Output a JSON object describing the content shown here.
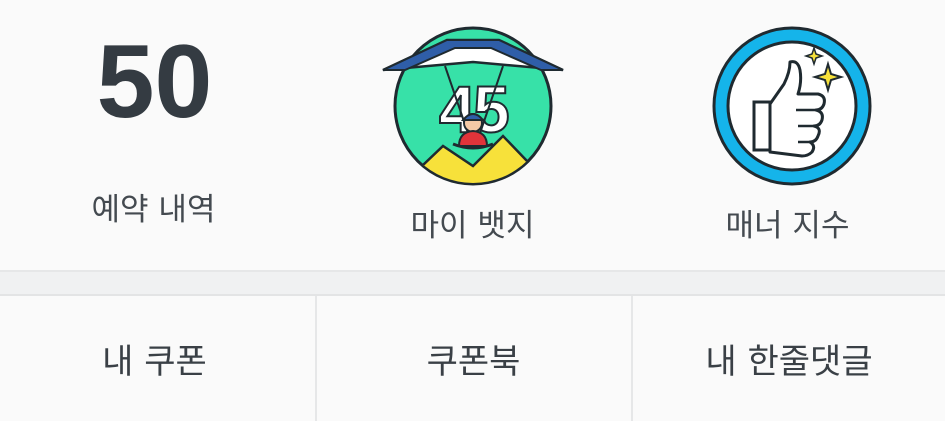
{
  "stats": {
    "reservations": {
      "count": "50",
      "label": "예약 내역"
    },
    "badge": {
      "number": "45",
      "label": "마이 뱃지",
      "icon": "hang-glider-badge-icon"
    },
    "manner": {
      "label": "매너 지수",
      "icon": "thumbs-up-icon",
      "accent_color": "#15b4ea"
    }
  },
  "menu": {
    "items": [
      {
        "label": "내 쿠폰"
      },
      {
        "label": "쿠폰북"
      },
      {
        "label": "내 한줄댓글"
      }
    ]
  },
  "colors": {
    "badge_bg": "#37e1a8",
    "badge_wing": "#2f5ea8",
    "manner_ring": "#15b4ea"
  }
}
